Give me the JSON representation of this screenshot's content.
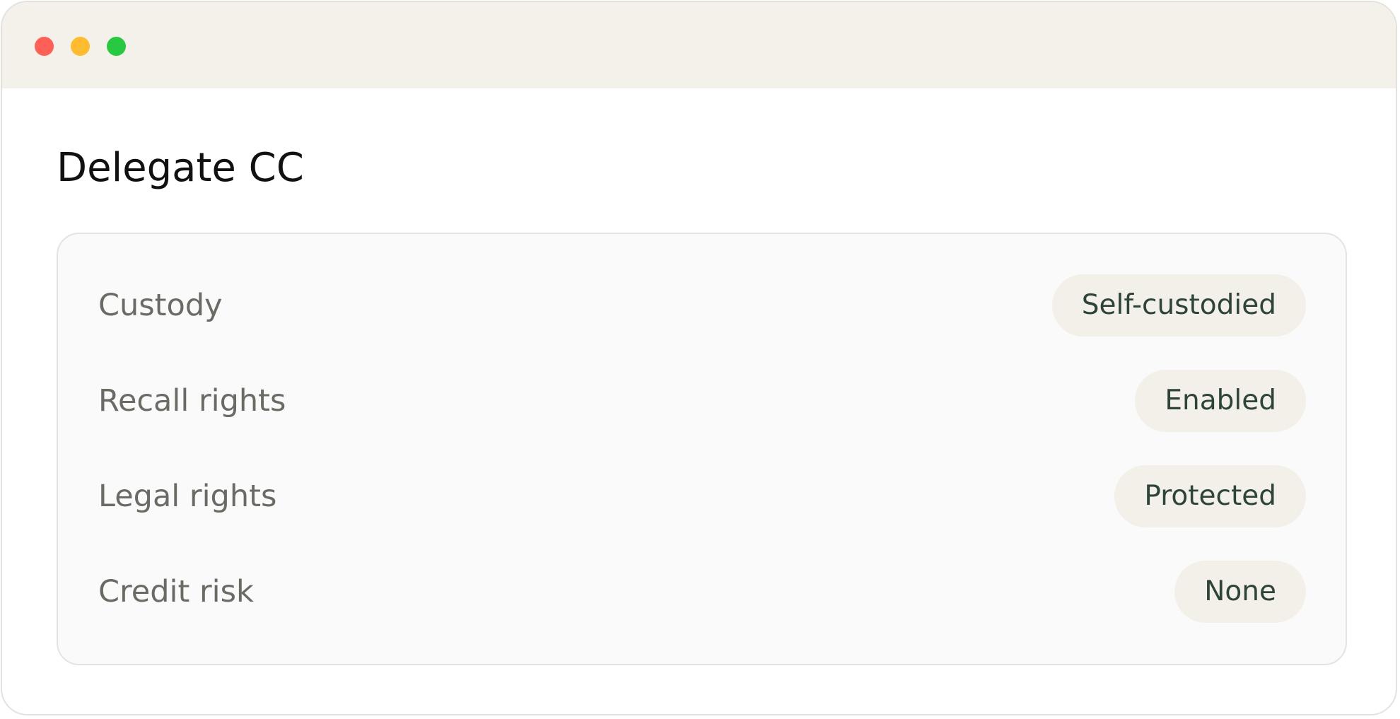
{
  "window": {
    "controls": [
      "close-control",
      "minimize-control",
      "maximize-control"
    ]
  },
  "page": {
    "title": "Delegate CC"
  },
  "rows": [
    {
      "label": "Custody",
      "value": "Self-custodied"
    },
    {
      "label": "Recall rights",
      "value": "Enabled"
    },
    {
      "label": "Legal rights",
      "value": "Protected"
    },
    {
      "label": "Credit risk",
      "value": "None"
    }
  ],
  "colors": {
    "titlebar": "#f4f1ea",
    "close": "#fe5f57",
    "minimize": "#febc2e",
    "maximize": "#28c840",
    "pill_background": "#f2f0e9",
    "pill_text": "#2e4436",
    "label_text": "#6b6b66"
  }
}
